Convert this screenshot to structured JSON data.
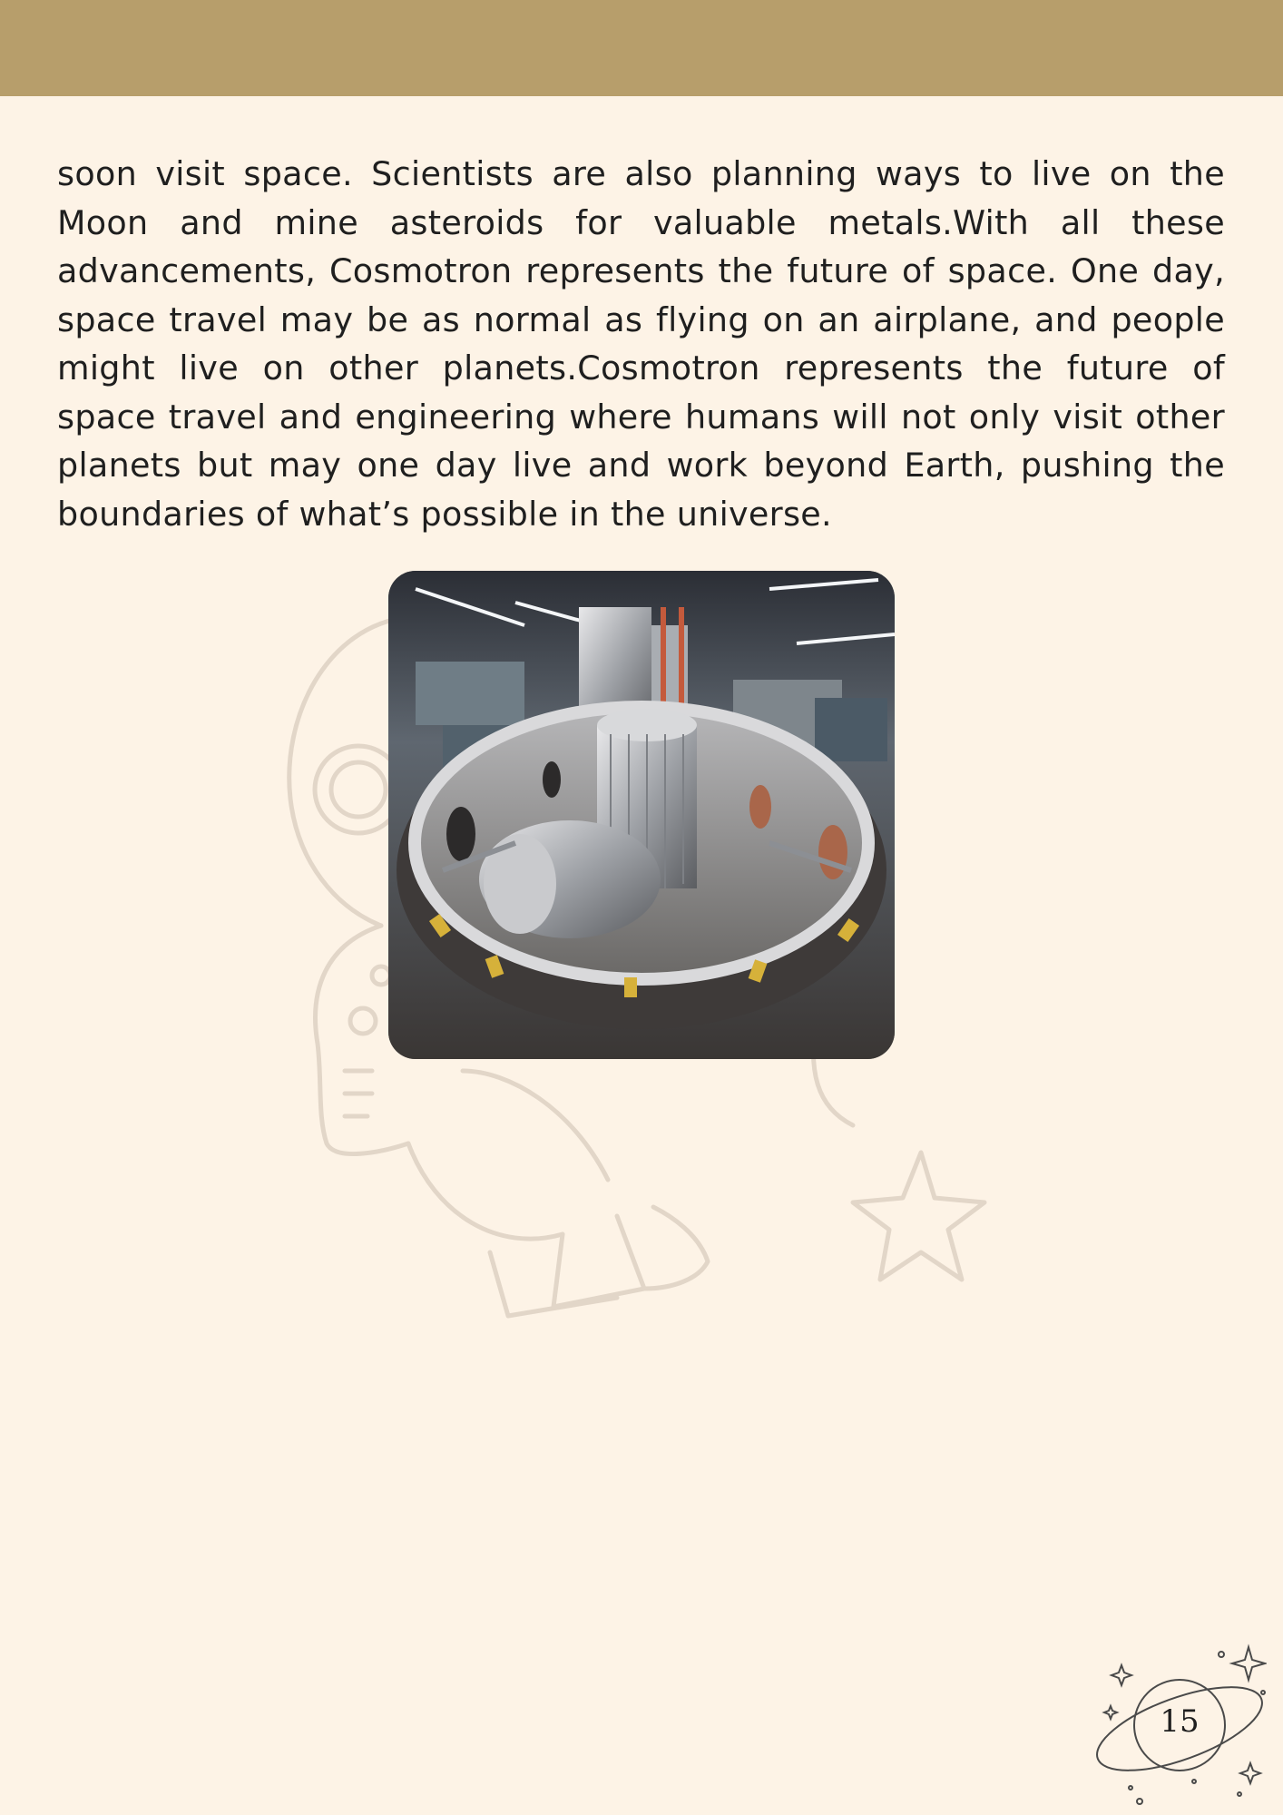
{
  "header": {
    "band_color": "#b79e6b"
  },
  "page": {
    "background": "#fdf3e6",
    "body_text": " soon visit space. Scientists are also planning ways to live on the Moon and mine asteroids for valuable metals.With all these advancements, Cosmotron represents the future of space. One day, space travel may be as normal as flying on an airplane, and people might live on other planets.Cosmotron represents the future of space travel and engineering where humans will not only visit other planets but may one day live and work beyond Earth, pushing the boundaries of what’s possible in the universe."
  },
  "figure": {
    "icon": "engineering-lab-photo"
  },
  "decorations": {
    "watermark_icon": "astronaut-with-star-outline",
    "badge_icon": "planet-ring-icon"
  },
  "footer": {
    "page_number": "15"
  }
}
